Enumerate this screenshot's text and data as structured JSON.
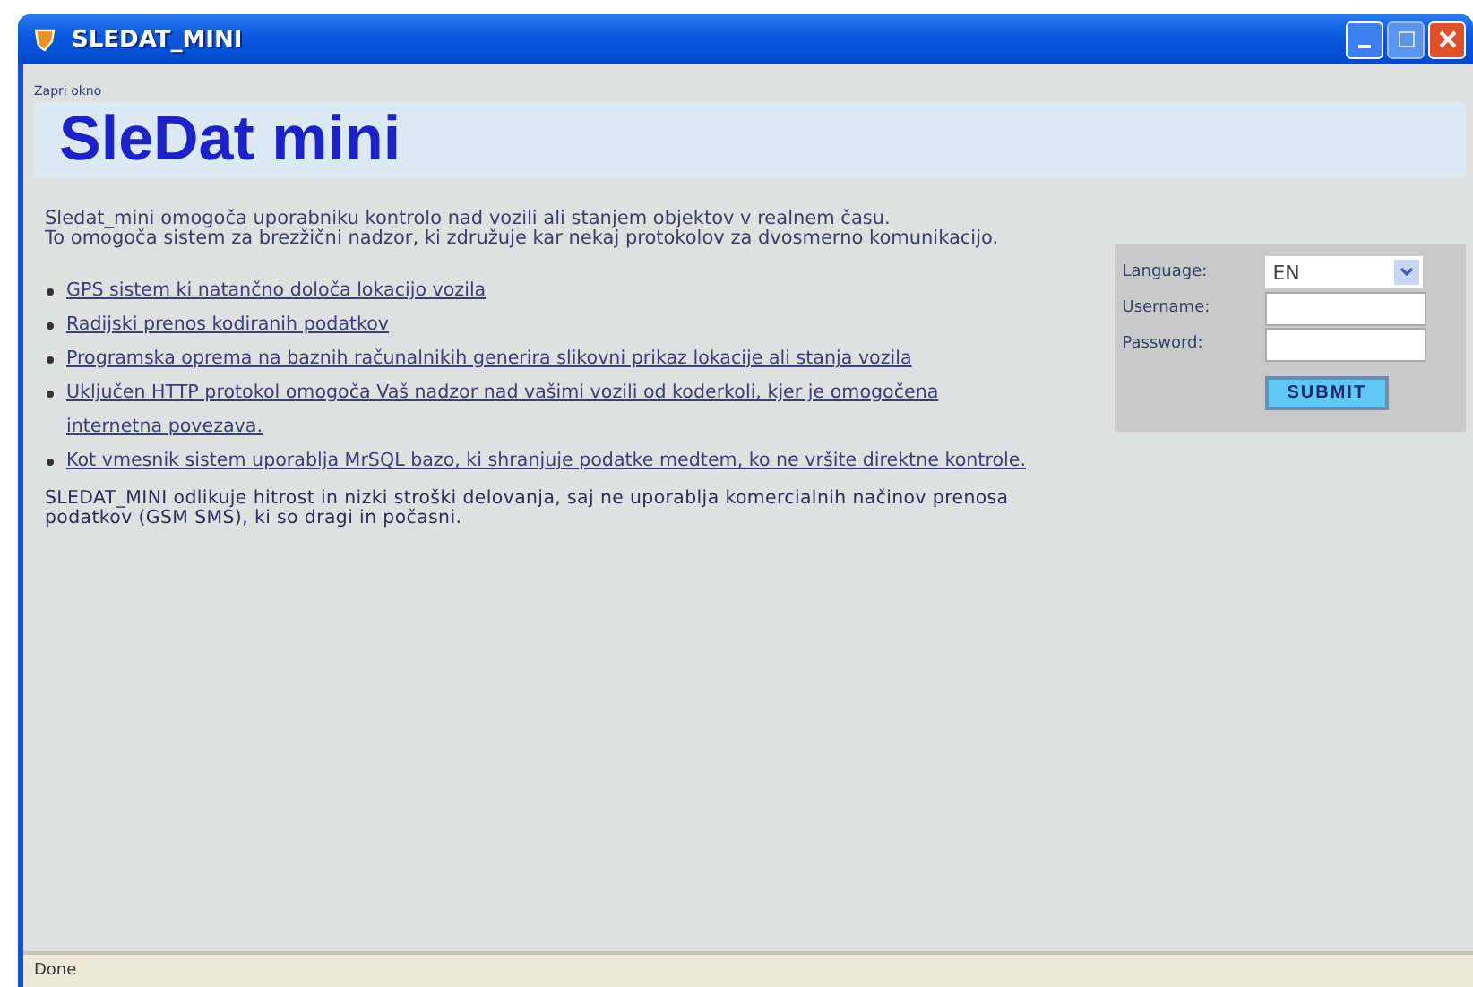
{
  "window": {
    "title": "SLEDAT_MINI"
  },
  "top_link": "Zapri okno",
  "heading": "SleDat mini",
  "intro": [
    "Sledat_mini omogoča uporabniku kontrolo nad vozili ali stanjem objektov v realnem času.",
    "To omogoča sistem za brezžični nadzor, ki združuje kar nekaj protokolov za dvosmerno komunikacijo."
  ],
  "features": [
    {
      "lines": [
        "GPS sistem ki natančno določa lokacijo vozila"
      ]
    },
    {
      "lines": [
        "Radijski prenos kodiranih podatkov"
      ]
    },
    {
      "lines": [
        "Programska oprema na baznih računalnikih generira slikovni prikaz lokacije ali stanja vozila"
      ]
    },
    {
      "lines": [
        "Uključen HTTP protokol omogoča Vaš nadzor nad vašimi vozili od koderkoli, kjer je omogočena",
        "internetna povezava."
      ]
    },
    {
      "lines": [
        "Kot vmesnik sistem uporablja MrSQL bazo, ki shranjuje podatke medtem, ko ne vršite direktne kontrole."
      ]
    }
  ],
  "summary": "SLEDAT_MINI odlikuje hitrost in nizki stroški delovanja, saj ne uporablja komercialnih načinov prenosa podatkov (GSM SMS), ki so dragi in počasni.",
  "login": {
    "language_label": "Language:",
    "language_value": "EN",
    "username_label": "Username:",
    "password_label": "Password:",
    "submit": "SUBMIT"
  },
  "status_bar": "Done"
}
